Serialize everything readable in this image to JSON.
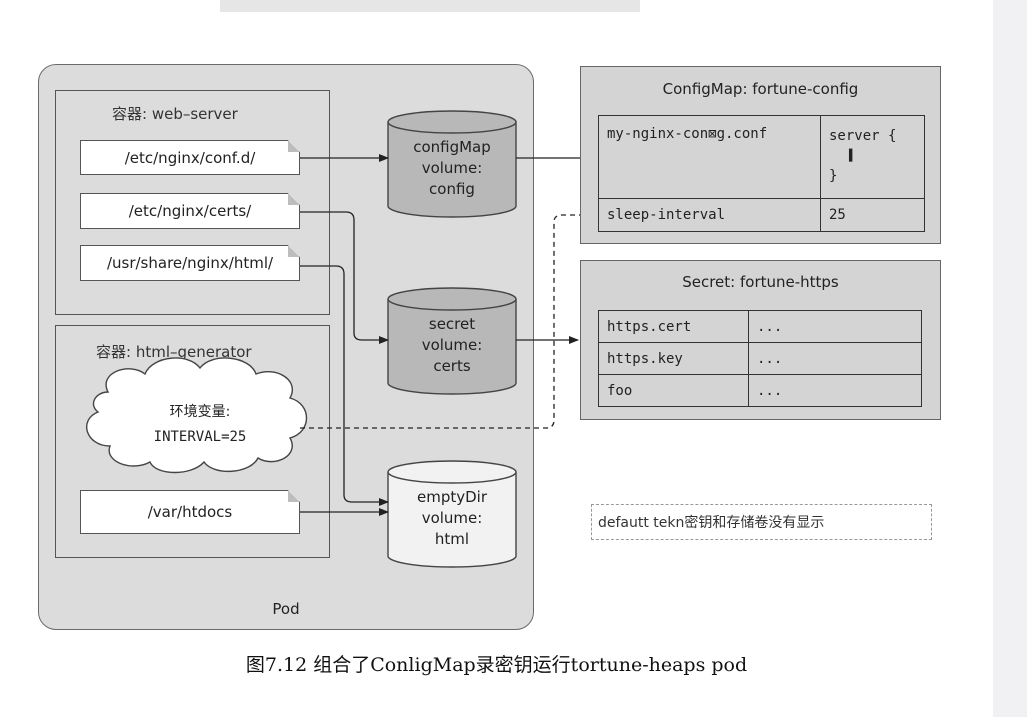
{
  "pod": {
    "label": "Pod"
  },
  "containers": {
    "web_server": {
      "title": "容器: web–server",
      "mounts": [
        "/etc/nginx/conf.d/",
        "/etc/nginx/certs/",
        "/usr/share/nginx/html/"
      ]
    },
    "html_generator": {
      "title": "容器: html–generator",
      "env_title": "环境变量:",
      "env_value": "INTERVAL=25",
      "mount": "/var/htdocs"
    }
  },
  "volumes": {
    "config": {
      "line1": "configMap",
      "line2": "volume:",
      "line3": "config",
      "color": "#b8b8b8"
    },
    "certs": {
      "line1": "secret",
      "line2": "volume:",
      "line3": "certs",
      "color": "#b8b8b8"
    },
    "html": {
      "line1": "emptyDir",
      "line2": "volume:",
      "line3": "html",
      "color": "#f2f2f2"
    }
  },
  "configmap": {
    "title": "ConfigMap: fortune-config",
    "rows": [
      {
        "key": "my-nginx-con⊠g.conf",
        "val1": "server {",
        "val2": "▌",
        "val3": "}"
      },
      {
        "key": "sleep-interval",
        "val1": "25"
      }
    ]
  },
  "secret": {
    "title": "Secret: fortune-https",
    "rows": [
      {
        "key": "https.cert",
        "val": "..."
      },
      {
        "key": "https.key",
        "val": "..."
      },
      {
        "key": "foo",
        "val": "..."
      }
    ]
  },
  "note": "defautt tekn密钥和存储卷没有显示",
  "caption": "图7.12 组合了ConligMap录密钥运行tortune-heaps pod"
}
